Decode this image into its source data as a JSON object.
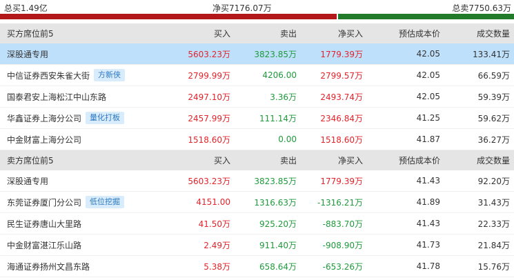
{
  "summary": {
    "total_buy": "总买1.49亿",
    "net_buy": "净买7176.07万",
    "total_sell": "总卖7750.63万"
  },
  "colors": {
    "buy_bar": "#b3181b",
    "sell_bar": "#227a2b",
    "up": "#e3222a",
    "down": "#1e9a3c",
    "highlight": "#bfe0fb"
  },
  "buy_section": {
    "header": {
      "name": "买方席位前5",
      "buy": "买入",
      "sell": "卖出",
      "net": "净买入",
      "cost": "预估成本价",
      "vol": "成交数量"
    },
    "rows": [
      {
        "name": "深股通专用",
        "tag": "",
        "buy": "5603.23万",
        "sell": "3823.85万",
        "net": "1779.39万",
        "net_dir": "red",
        "cost": "42.05",
        "vol": "133.41万"
      },
      {
        "name": "中信证券西安朱雀大街",
        "tag": "方新侠",
        "buy": "2799.99万",
        "sell": "4206.00",
        "net": "2799.57万",
        "net_dir": "red",
        "cost": "42.05",
        "vol": "66.59万"
      },
      {
        "name": "国泰君安上海松江中山东路",
        "tag": "",
        "buy": "2497.10万",
        "sell": "3.36万",
        "net": "2493.74万",
        "net_dir": "red",
        "cost": "42.05",
        "vol": "59.39万"
      },
      {
        "name": "华鑫证券上海分公司",
        "tag": "量化打板",
        "buy": "2457.99万",
        "sell": "111.14万",
        "net": "2346.84万",
        "net_dir": "red",
        "cost": "41.25",
        "vol": "59.62万"
      },
      {
        "name": "中金财富上海分公司",
        "tag": "",
        "buy": "1518.60万",
        "sell": "0.00",
        "net": "1518.60万",
        "net_dir": "red",
        "cost": "41.87",
        "vol": "36.27万"
      }
    ]
  },
  "sell_section": {
    "header": {
      "name": "卖方席位前5",
      "buy": "买入",
      "sell": "卖出",
      "net": "净买入",
      "cost": "预估成本价",
      "vol": "成交数量"
    },
    "rows": [
      {
        "name": "深股通专用",
        "tag": "",
        "buy": "5603.23万",
        "sell": "3823.85万",
        "net": "1779.39万",
        "net_dir": "red",
        "cost": "41.43",
        "vol": "92.20万"
      },
      {
        "name": "东莞证券厦门分公司",
        "tag": "低位挖掘",
        "buy": "4151.00",
        "sell": "1316.63万",
        "net": "-1316.21万",
        "net_dir": "green",
        "cost": "41.89",
        "vol": "31.43万"
      },
      {
        "name": "民生证券唐山大里路",
        "tag": "",
        "buy": "41.50万",
        "sell": "925.20万",
        "net": "-883.70万",
        "net_dir": "green",
        "cost": "41.43",
        "vol": "22.33万"
      },
      {
        "name": "中金财富湛江乐山路",
        "tag": "",
        "buy": "2.49万",
        "sell": "911.40万",
        "net": "-908.90万",
        "net_dir": "green",
        "cost": "41.73",
        "vol": "21.84万"
      },
      {
        "name": "海通证券扬州文昌东路",
        "tag": "",
        "buy": "5.38万",
        "sell": "658.64万",
        "net": "-653.26万",
        "net_dir": "green",
        "cost": "41.78",
        "vol": "15.76万"
      }
    ]
  }
}
